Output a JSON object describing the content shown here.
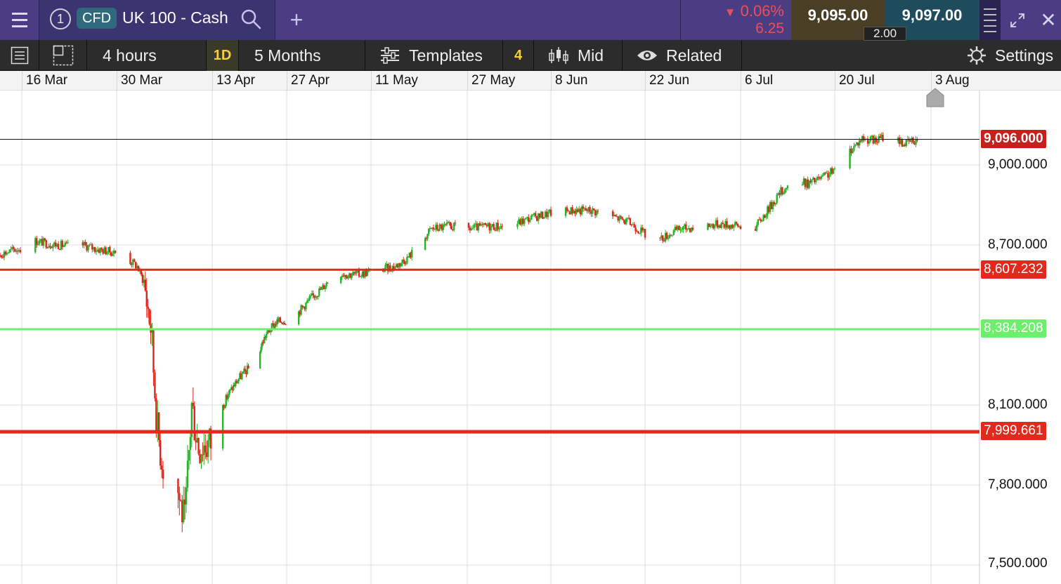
{
  "topbar": {
    "tab_number": "1",
    "product_badge": "CFD",
    "instrument_name": "UK 100 - Cash",
    "add_tab_label": "+",
    "change_percent": "0.06%",
    "change_points": "6.25",
    "change_direction_icon": "triangle-down-icon",
    "sell_price": "9,095.00",
    "buy_price": "9,097.00",
    "spread": "2.00",
    "close_label": "✕",
    "colors": {
      "bar": "#4b3d83",
      "down": "#e8505a",
      "sell_bg": "#4a3e25",
      "buy_bg": "#1f4c5c"
    }
  },
  "toolbar": {
    "interval": "4 hours",
    "interval_short": "1D",
    "range": "5 Months",
    "templates": "Templates",
    "templates_count": "4",
    "price_type": "Mid",
    "related": "Related",
    "settings": "Settings"
  },
  "time_axis": {
    "labels": [
      "16 Mar",
      "30 Mar",
      "13 Apr",
      "27 Apr",
      "11 May",
      "27 May",
      "8 Jun",
      "22 Jun",
      "6 Jul",
      "20 Jul",
      "3 Aug"
    ]
  },
  "price_axis": {
    "labels": [
      "9,000.000",
      "8,700.000",
      "8,100.000",
      "7,800.000",
      "7,500.000"
    ],
    "values": [
      9000,
      8700,
      8100,
      7800,
      7500
    ]
  },
  "last_price": {
    "label": "9,096.000",
    "value": 9096,
    "color": "#c4201c"
  },
  "levels": [
    {
      "label": "8,607.232",
      "value": 8607.232,
      "color": "#e02a1e"
    },
    {
      "label": "8,384.208",
      "value": 8384.208,
      "color": "#6cf06c"
    },
    {
      "label": "7,999.661",
      "value": 7999.661,
      "color": "#e02a1e"
    }
  ],
  "chart_data": {
    "type": "candlestick",
    "instrument": "UK 100 - Cash",
    "interval": "4 hours",
    "range": "5 Months",
    "x_ticks": [
      "16 Mar",
      "30 Mar",
      "13 Apr",
      "27 Apr",
      "11 May",
      "27 May",
      "8 Jun",
      "22 Jun",
      "6 Jul",
      "20 Jul",
      "3 Aug"
    ],
    "y_ticks": [
      9000,
      8700,
      8100,
      7800,
      7500
    ],
    "ylim": [
      7430,
      9170
    ],
    "up_color": "#27b327",
    "down_color": "#e0241c",
    "grid": true,
    "close_path": [
      [
        "10 Mar",
        8640
      ],
      [
        "12 Mar",
        8660
      ],
      [
        "16 Mar",
        8690
      ],
      [
        "18 Mar",
        8715
      ],
      [
        "20 Mar",
        8705
      ],
      [
        "23 Mar",
        8695
      ],
      [
        "25 Mar",
        8700
      ],
      [
        "27 Mar",
        8685
      ],
      [
        "30 Mar",
        8670
      ],
      [
        "1 Apr",
        8640
      ],
      [
        "2 Apr",
        8620
      ],
      [
        "3 Apr",
        8560
      ],
      [
        "4 Apr",
        8400
      ],
      [
        "5 Apr",
        8000
      ],
      [
        "6 Apr",
        7850
      ],
      [
        "7 Apr",
        7650
      ],
      [
        "8 Apr",
        7780
      ],
      [
        "9 Apr",
        7650
      ],
      [
        "10 Apr",
        8100
      ],
      [
        "11 Apr",
        7950
      ],
      [
        "13 Apr",
        7960
      ],
      [
        "14 Apr",
        8050
      ],
      [
        "16 Apr",
        8140
      ],
      [
        "18 Apr",
        8200
      ],
      [
        "21 Apr",
        8260
      ],
      [
        "23 Apr",
        8360
      ],
      [
        "25 Apr",
        8410
      ],
      [
        "27 Apr",
        8420
      ],
      [
        "29 Apr",
        8450
      ],
      [
        "1 May",
        8500
      ],
      [
        "3 May",
        8540
      ],
      [
        "5 May",
        8600
      ],
      [
        "7 May",
        8590
      ],
      [
        "9 May",
        8590
      ],
      [
        "11 May",
        8600
      ],
      [
        "13 May",
        8610
      ],
      [
        "15 May",
        8620
      ],
      [
        "17 May",
        8650
      ],
      [
        "19 May",
        8700
      ],
      [
        "21 May",
        8760
      ],
      [
        "24 May",
        8770
      ],
      [
        "27 May",
        8760
      ],
      [
        "30 May",
        8770
      ],
      [
        "2 Jun",
        8770
      ],
      [
        "5 Jun",
        8800
      ],
      [
        "8 Jun",
        8820
      ],
      [
        "11 Jun",
        8830
      ],
      [
        "14 Jun",
        8830
      ],
      [
        "17 Jun",
        8810
      ],
      [
        "20 Jun",
        8780
      ],
      [
        "22 Jun",
        8740
      ],
      [
        "24 Jun",
        8720
      ],
      [
        "27 Jun",
        8760
      ],
      [
        "30 Jun",
        8770
      ],
      [
        "3 Jul",
        8780
      ],
      [
        "6 Jul",
        8770
      ],
      [
        "8 Jul",
        8760
      ],
      [
        "10 Jul",
        8830
      ],
      [
        "12 Jul",
        8900
      ],
      [
        "14 Jul",
        8940
      ],
      [
        "16 Jul",
        8930
      ],
      [
        "18 Jul",
        8950
      ],
      [
        "20 Jul",
        8980
      ],
      [
        "22 Jul",
        9050
      ],
      [
        "24 Jul",
        9100
      ],
      [
        "26 Jul",
        9090
      ],
      [
        "28 Jul",
        9120
      ],
      [
        "30 Jul",
        9080
      ],
      [
        "1 Aug",
        9096
      ]
    ]
  }
}
